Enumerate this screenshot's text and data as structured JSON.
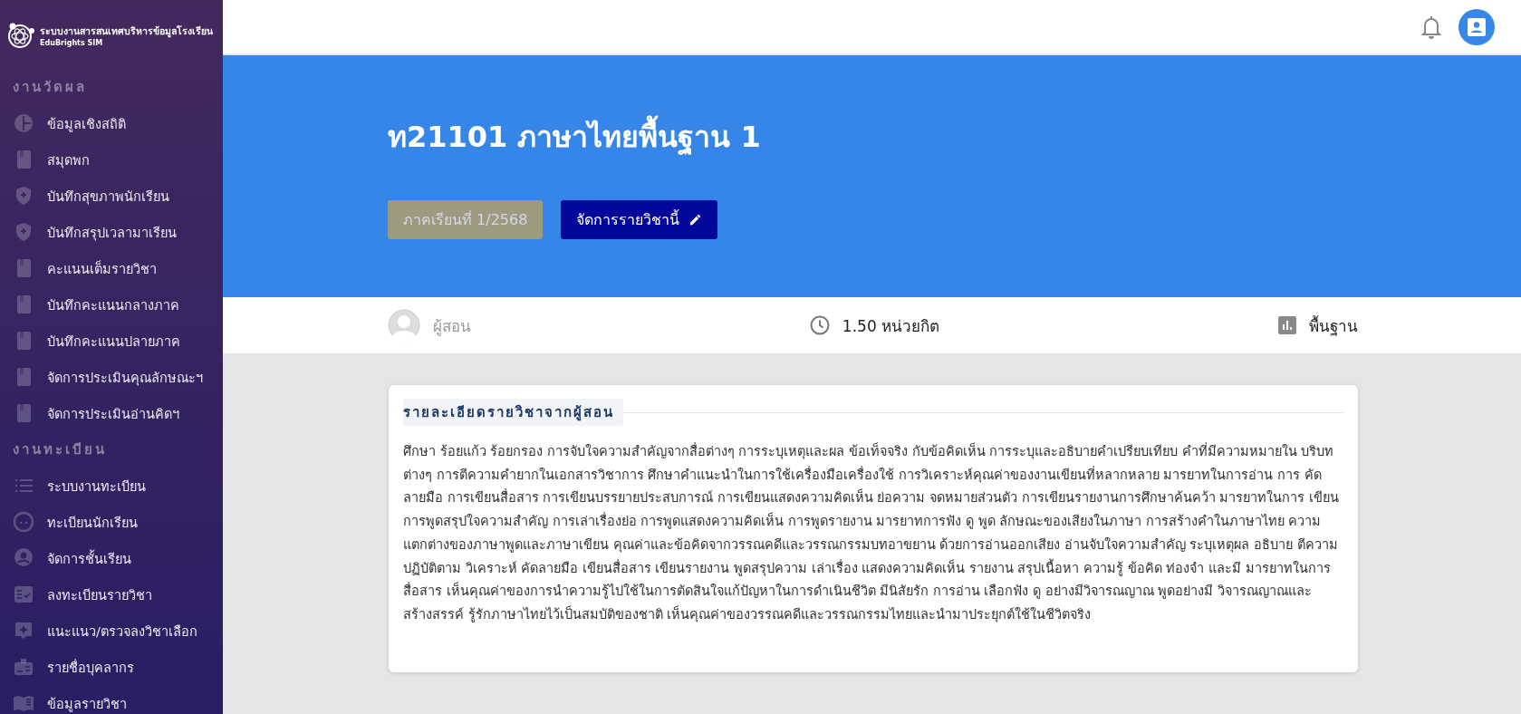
{
  "brand": {
    "title": "ระบบงานสารสนเทศบริหารข้อมูลโรงเรียน",
    "subtitle": "EduBrights SIM"
  },
  "sidebar": {
    "groups": [
      {
        "heading": "งานวัดผล",
        "items": [
          {
            "label": "ข้อมูลเชิงสถิติ"
          },
          {
            "label": "สมุดพก"
          },
          {
            "label": "บันทึกสุขภาพนักเรียน"
          },
          {
            "label": "บันทึกสรุปเวลามาเรียน"
          },
          {
            "label": "คะแนนเต็มรายวิชา"
          },
          {
            "label": "บันทึกคะแนนกลางภาค"
          },
          {
            "label": "บันทึกคะแนนปลายภาค"
          },
          {
            "label": "จัดการประเมินคุณลักษณะฯ"
          },
          {
            "label": "จัดการประเมินอ่านคิดฯ"
          }
        ]
      },
      {
        "heading": "งานทะเบียน",
        "items": [
          {
            "label": "ระบบงานทะเบียน"
          },
          {
            "label": "ทะเบียนนักเรียน"
          },
          {
            "label": "จัดการชั้นเรียน"
          },
          {
            "label": "ลงทะเบียนรายวิชา"
          },
          {
            "label": "แนะแนว/ตรวจลงวิชาเลือก"
          },
          {
            "label": "รายชื่อบุคลากร"
          },
          {
            "label": "ข้อมูลรายวิชา"
          }
        ]
      }
    ]
  },
  "course": {
    "title": "ท21101 ภาษาไทยพื้นฐาน 1",
    "semester_button": {
      "label": "ภาคเรียนที่ 1/2568",
      "disabled": true
    },
    "manage_button": {
      "label": "จัดการรายวิชานี้",
      "disabled": false
    }
  },
  "info": {
    "teacher": "ผู้สอน",
    "credits": "1.50 หน่วยกิต",
    "type": "พื้นฐาน"
  },
  "detail": {
    "heading": "รายละเอียดรายวิชาจากผู้สอน",
    "text": "ศึกษา ร้อยแก้ว ร้อยกรอง การจับใจความสำคัญจากสื่อต่างๆ การระบุเหตุและผล ข้อเท็จจริง กับข้อคิดเห็น การระบุและอธิบายคำเปรียบเทียบ คำที่มีความหมายใน บริบทต่างๆ การตีความคำยากในเอกสารวิชาการ ศึกษาคำแนะนำในการใช้เครื่องมือเครื่องใช้ การวิเคราะห์คุณค่าของงานเขียนที่หลากหลาย มารยาทในการอ่าน การ คัดลายมือ การเขียนสื่อสาร การเขียนบรรยายประสบการณ์ การเขียนแสดงความคิดเห็น ย่อความ จดหมายส่วนตัว การเขียนรายงานการศึกษาค้นคว้า มารยาทในการ เขียน การพูดสรุปใจความสำคัญ การเล่าเรื่องย่อ การพูดแสดงความคิดเห็น การพูดรายงาน มารยาทการฟัง ดู พูด ลักษณะของเสียงในภาษา การสร้างคำในภาษาไทย ความแตกต่างของภาษาพูดและภาษาเขียน คุณค่าและข้อคิดจากวรรณคดีและวรรณกรรมบทอาขยาน ด้วยการอ่านออกเสียง อ่านจับใจความสำคัญ ระบุเหตุผล อธิบาย ตีความ ปฏิบัติตาม วิเคราะห์ คัดลายมือ เขียนสื่อสาร เขียนรายงาน พูดสรุปความ เล่าเรื่อง แสดงความคิดเห็น รายงาน สรุปเนื้อหา ความรู้ ข้อคิด ท่องจำ และมี มารยาทในการสื่อสาร เห็นคุณค่าของการนำความรู้ไปใช้ในการตัดสินใจแก้ปัญหาในการดำเนินชีวิต มีนิสัยรัก การอ่าน เลือกฟัง ดู อย่างมีวิจารณญาณ พูดอย่างมี วิจารณญาณและสร้างสรรค์ รู้รักภาษาไทยไว้เป็นสมบัติของชาติ เห็นคุณค่าของวรรณคดีและวรรณกรรมไทยและนำมาประยุกต์ใช้ในชีวิตจริง"
  }
}
